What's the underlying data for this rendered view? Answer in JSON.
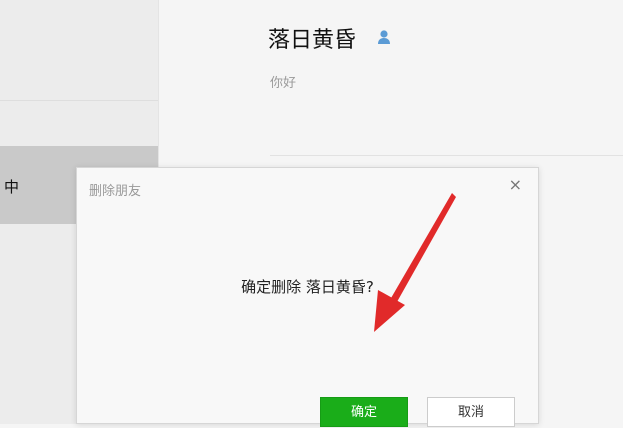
{
  "sidebar": {
    "selected_item_text": "中"
  },
  "profile": {
    "name": "落日黄昏",
    "signature": "你好",
    "icon": "person-icon"
  },
  "dialog": {
    "title": "删除朋友",
    "close_label": "×",
    "message": "确定删除 落日黄昏?",
    "ok_label": "确定",
    "cancel_label": "取消"
  },
  "colors": {
    "accent_green": "#1aad19",
    "arrow_red": "#e12a2a",
    "profile_icon_blue": "#5b9bd5"
  }
}
